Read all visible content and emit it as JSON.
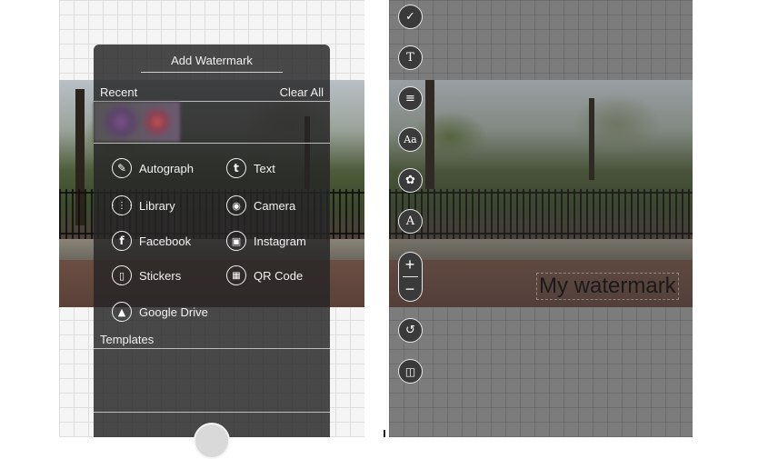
{
  "left": {
    "panel": {
      "title": "Add Watermark",
      "recent_label": "Recent",
      "clear_all_label": "Clear All",
      "templates_label": "Templates"
    },
    "menu": {
      "autograph": {
        "label": "Autograph",
        "icon": "autograph-pen-icon"
      },
      "text": {
        "label": "Text",
        "icon": "text-t-icon"
      },
      "library": {
        "label": "Library",
        "icon": "library-grid-icon"
      },
      "camera": {
        "label": "Camera",
        "icon": "camera-icon"
      },
      "facebook": {
        "label": "Facebook",
        "icon": "facebook-icon"
      },
      "instagram": {
        "label": "Instagram",
        "icon": "instagram-icon"
      },
      "stickers": {
        "label": "Stickers",
        "icon": "stickers-icon"
      },
      "qr_code": {
        "label": "QR Code",
        "icon": "qr-code-icon"
      },
      "google_drive": {
        "label": "Google Drive",
        "icon": "google-drive-icon"
      }
    }
  },
  "right": {
    "watermark_text": "My watermark",
    "toolbar": {
      "confirm_icon": "checkmark-icon",
      "text_icon": "text-t-icon",
      "opacity_icon": "layers-icon",
      "font_icon": "font-aa-icon",
      "color_icon": "palette-icon",
      "style_icon": "font-style-icon",
      "zoom_in": "+",
      "zoom_out": "−",
      "rotate_icon": "rotate-icon",
      "delete_icon": "trash-icon"
    }
  },
  "colors": {
    "panel_bg": "#262626",
    "right_bg": "#7c7c7c",
    "text_light": "#f3f3f3"
  }
}
